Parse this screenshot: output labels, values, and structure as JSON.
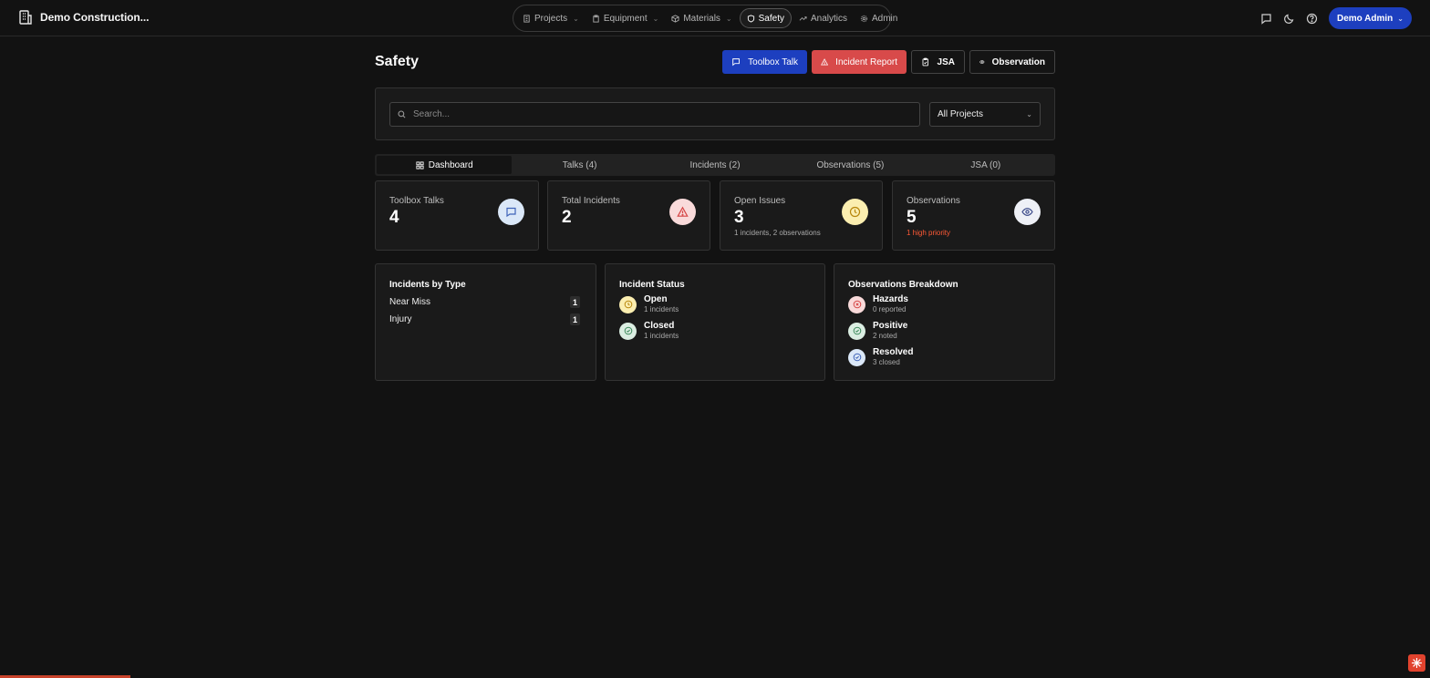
{
  "app": {
    "org_name": "Demo Construction..."
  },
  "nav": {
    "items": [
      {
        "label": "Projects",
        "icon": "building-icon",
        "dropdown": true
      },
      {
        "label": "Equipment",
        "icon": "clipboard-icon",
        "dropdown": true
      },
      {
        "label": "Materials",
        "icon": "package-icon",
        "dropdown": true
      },
      {
        "label": "Safety",
        "icon": "shield-icon",
        "active": true
      },
      {
        "label": "Analytics",
        "icon": "trending-icon"
      },
      {
        "label": "Admin",
        "icon": "gear-icon"
      }
    ],
    "user_label": "Demo Admin"
  },
  "page": {
    "title": "Safety",
    "actions": {
      "toolbox_talk": "Toolbox Talk",
      "incident_report": "Incident Report",
      "jsa": "JSA",
      "observation": "Observation"
    }
  },
  "filters": {
    "search_placeholder": "Search...",
    "project_select": "All Projects"
  },
  "tabs": [
    {
      "label": "Dashboard",
      "active": true
    },
    {
      "label": "Talks (4)"
    },
    {
      "label": "Incidents (2)"
    },
    {
      "label": "Observations (5)"
    },
    {
      "label": "JSA (0)"
    }
  ],
  "stats": {
    "toolbox_talks": {
      "label": "Toolbox Talks",
      "value": "4"
    },
    "total_incidents": {
      "label": "Total Incidents",
      "value": "2"
    },
    "open_issues": {
      "label": "Open Issues",
      "value": "3",
      "sub": "1 incidents, 2 observations"
    },
    "observations": {
      "label": "Observations",
      "value": "5",
      "sub": "1 high priority"
    }
  },
  "incidents_by_type": {
    "title": "Incidents by Type",
    "rows": [
      {
        "label": "Near Miss",
        "count": "1"
      },
      {
        "label": "Injury",
        "count": "1"
      }
    ]
  },
  "incident_status": {
    "title": "Incident Status",
    "rows": [
      {
        "label": "Open",
        "sub": "1 incidents"
      },
      {
        "label": "Closed",
        "sub": "1 incidents"
      }
    ]
  },
  "observations_breakdown": {
    "title": "Observations Breakdown",
    "rows": [
      {
        "label": "Hazards",
        "sub": "0 reported"
      },
      {
        "label": "Positive",
        "sub": "2 noted"
      },
      {
        "label": "Resolved",
        "sub": "3 closed"
      }
    ]
  },
  "colors": {
    "accent_blue": "#1d3fbf",
    "danger_red": "#d84a4a",
    "high_priority": "#ff5a36",
    "background": "#121212"
  }
}
